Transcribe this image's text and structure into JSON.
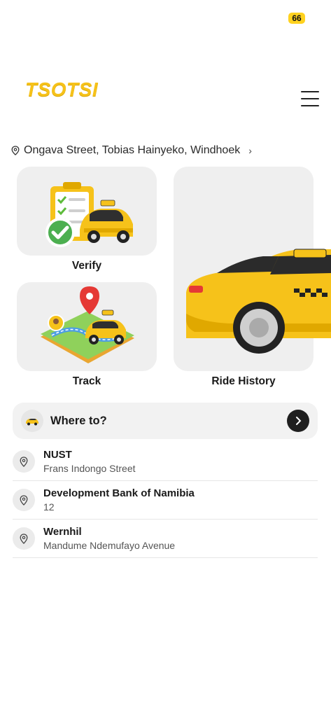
{
  "status_bar": {
    "battery": "66"
  },
  "header": {
    "logo": "TSOTSI"
  },
  "location": {
    "address": "Ongava Street, Tobias Hainyeko, Windhoek"
  },
  "tiles": {
    "verify": "Verify",
    "track": "Track",
    "ride_history": "Ride History"
  },
  "search": {
    "label": "Where to?"
  },
  "places": [
    {
      "title": "NUST",
      "subtitle": "Frans Indongo Street"
    },
    {
      "title": "Development Bank of Namibia",
      "subtitle": "12"
    },
    {
      "title": "Wernhil",
      "subtitle": "Mandume Ndemufayo Avenue"
    }
  ],
  "colors": {
    "brand_yellow": "#F6C21A",
    "card_bg": "#EFEFEF",
    "dark": "#1f1f1f"
  },
  "icons": [
    "location-pin-icon",
    "chevron-right-icon",
    "menu-icon",
    "taxi-icon",
    "arrow-right-icon"
  ]
}
